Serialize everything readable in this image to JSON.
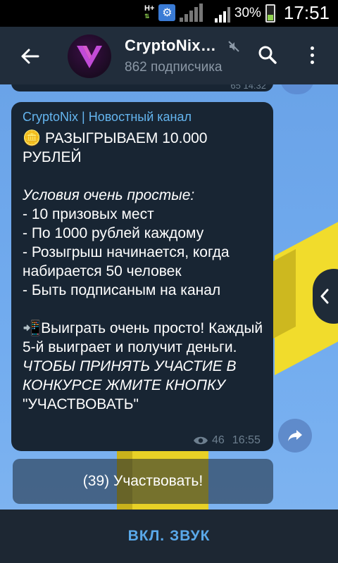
{
  "status_bar": {
    "net_label": "H+",
    "battery_percent": "30%",
    "time": "17:51",
    "icons": [
      "network-activity-icon",
      "gear-notification-icon",
      "signal-weak-icon",
      "signal-icon",
      "battery-charging-icon"
    ]
  },
  "header": {
    "channel_name": "CryptoNix…",
    "subscribers": "862 подписчика",
    "icons": [
      "back-arrow-icon",
      "channel-avatar",
      "muted-icon",
      "search-icon",
      "more-vert-icon"
    ]
  },
  "previous_message": {
    "meta": "65  14:32"
  },
  "message": {
    "author": "CryptoNix | Новостный канал",
    "headline": "🪙 РАЗЫГРЫВАЕМ 10.000 РУБЛЕЙ",
    "conditions_intro": "Условия очень простые:",
    "conditions": [
      "- 10 призовых мест",
      "- По 1000 рублей каждому",
      "- Розыгрыш начинается, когда набирается 50 человек",
      "- Быть подписаным на канал"
    ],
    "win_text": "📲Выиграть очень просто! Каждый 5-й выиграет и получит деньги.",
    "cta_text": " ЧТОБЫ ПРИНЯТЬ УЧАСТИЕ В КОНКУРСЕ ЖМИТЕ КНОПКУ ",
    "cta_quote": "\"УЧАСТВОВАТЬ\"",
    "views": "46",
    "time": "16:55"
  },
  "inline_button": {
    "label": "(39) Участвовать!"
  },
  "bottom_bar": {
    "unmute_label": "ВКЛ. ЗВУК"
  },
  "colors": {
    "header_bg": "#212d3b",
    "bubble_bg": "#182533",
    "author": "#64b5ef",
    "accent": "#5aa9ea",
    "wallpaper": "#72acef"
  }
}
